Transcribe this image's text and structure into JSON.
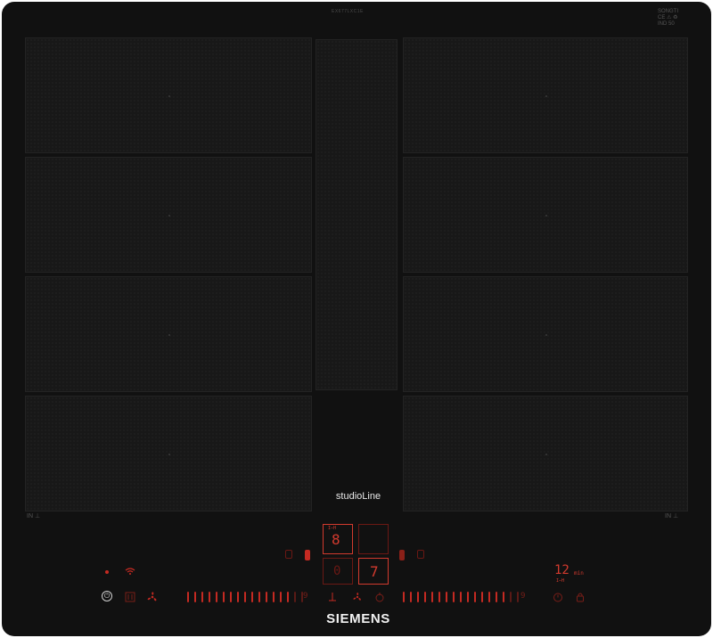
{
  "header": {
    "serial_text": "EX677LXC1E",
    "certification": [
      "SONGTI",
      "CE ⚠ ♻",
      "IND 50"
    ]
  },
  "brand": {
    "series": "studioLine",
    "logo": "SIEMENS"
  },
  "corners": {
    "left_label": "IN ⊥",
    "right_label": "IN ⊥"
  },
  "cooktop": {
    "left_zones": 4,
    "right_zones": 4,
    "center_strip": 1
  },
  "controls": {
    "left_heat_level": "8",
    "left_sub_display": "0",
    "center_right_level": "7",
    "left_indicator_label": "I–H",
    "timer": {
      "value": "12",
      "unit": "min",
      "sub_label": "I–H"
    },
    "slider_left_max_label": "9",
    "slider_right_max_label": "9",
    "slider_left_ticks": 17,
    "slider_right_ticks": 17
  },
  "colors": {
    "glass": "#111111",
    "led_red": "#d23a2e",
    "led_dim": "#5a1a16",
    "text_white": "#e8e8e8"
  },
  "icons": {
    "power": "power-icon",
    "wifi": "wifi-icon",
    "home_connect": "home-connect-icon",
    "fan": "fan-icon",
    "timer": "timer-icon",
    "lock": "lock-icon"
  }
}
